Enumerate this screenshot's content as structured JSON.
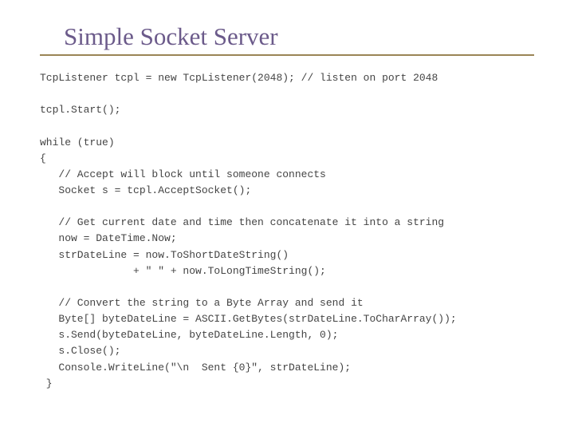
{
  "title": "Simple Socket Server",
  "code": "TcpListener tcpl = new TcpListener(2048); // listen on port 2048\n\ntcpl.Start();\n\nwhile (true)\n{\n   // Accept will block until someone connects\n   Socket s = tcpl.AcceptSocket();\n\n   // Get current date and time then concatenate it into a string\n   now = DateTime.Now;\n   strDateLine = now.ToShortDateString()\n               + \" \" + now.ToLongTimeString();\n\n   // Convert the string to a Byte Array and send it\n   Byte[] byteDateLine = ASCII.GetBytes(strDateLine.ToCharArray());\n   s.Send(byteDateLine, byteDateLine.Length, 0);\n   s.Close();\n   Console.WriteLine(\"\\n  Sent {0}\", strDateLine);\n }"
}
